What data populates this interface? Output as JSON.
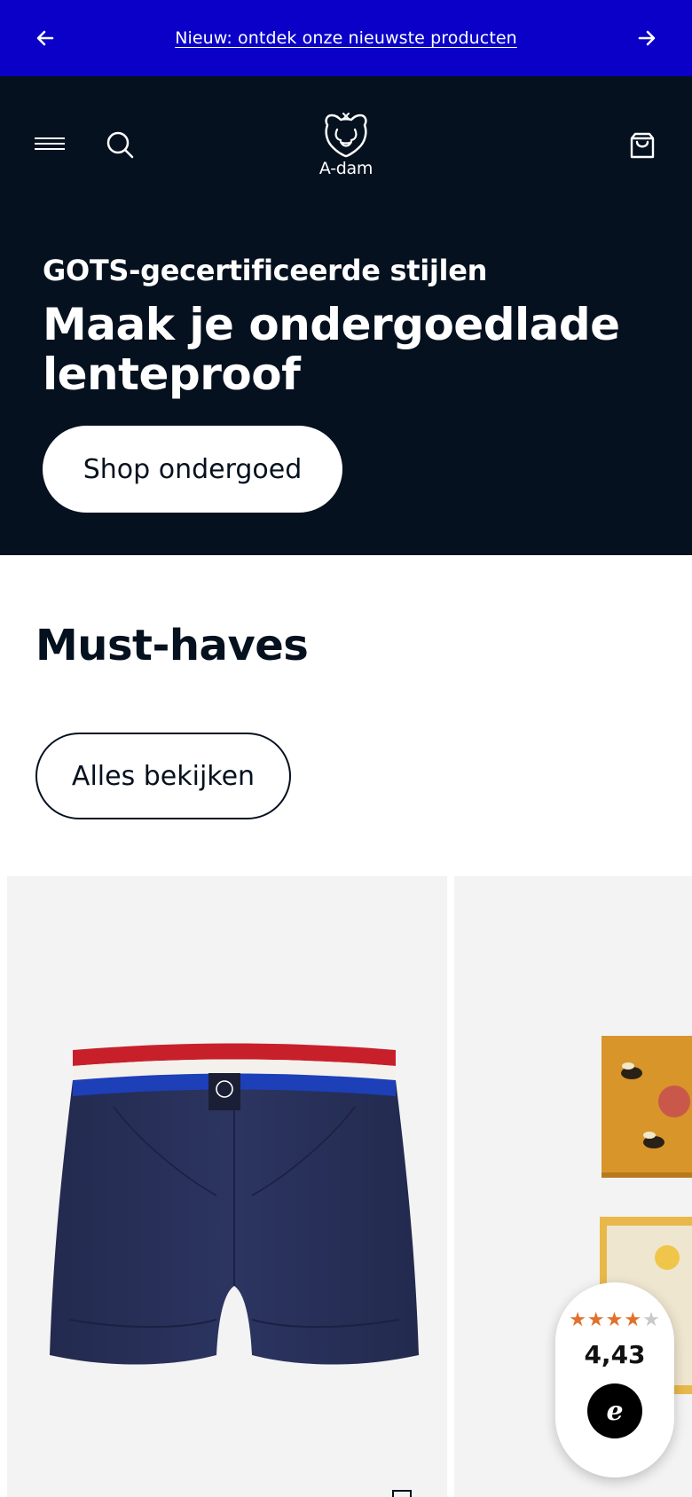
{
  "announcement": {
    "text": "Nieuw: ontdek onze nieuwste producten",
    "prev_icon": "arrow-left-icon",
    "next_icon": "arrow-right-icon",
    "background": "#0a00c8"
  },
  "header": {
    "brand": "A-dam",
    "menu_icon": "hamburger-menu-icon",
    "search_icon": "search-icon",
    "cart_icon": "shopping-bag-icon",
    "background": "#05111f"
  },
  "hero": {
    "eyebrow": "GOTS-gecertificeerde stijlen",
    "headline": "Maak je ondergoedlade lenteproof",
    "cta_label": "Shop ondergoed"
  },
  "must_haves": {
    "title": "Must-haves",
    "view_all_label": "Alles bekijken",
    "products": [
      {
        "image": "navy-boxer-brief-red-white-blue-waistband"
      },
      {
        "image": "yellow-bee-print-gift-box"
      }
    ]
  },
  "rating_widget": {
    "stars": "4.43 of 5",
    "score": "4,43",
    "badge_icon": "trusted-shops-e-icon",
    "star_color": "#e0722c"
  }
}
